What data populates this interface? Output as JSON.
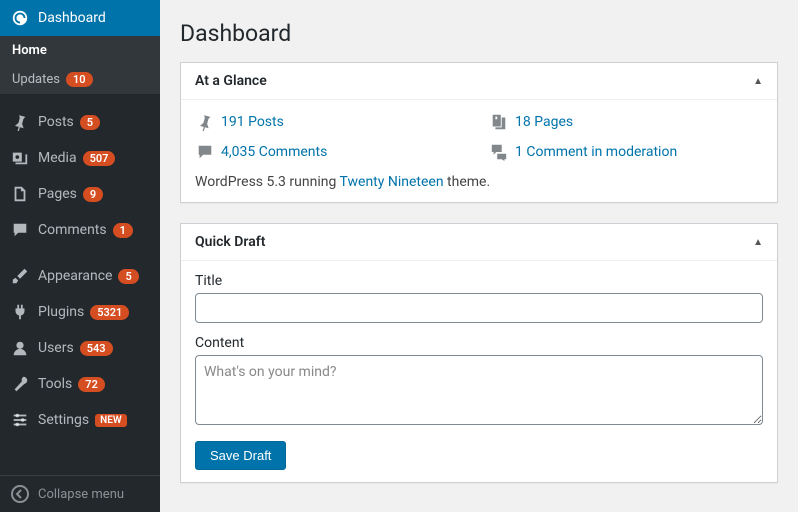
{
  "sidebar": {
    "items": [
      {
        "label": "Dashboard",
        "badge": null
      },
      {
        "label": "Posts",
        "badge": "5"
      },
      {
        "label": "Media",
        "badge": "507"
      },
      {
        "label": "Pages",
        "badge": "9"
      },
      {
        "label": "Comments",
        "badge": "1"
      },
      {
        "label": "Appearance",
        "badge": "5"
      },
      {
        "label": "Plugins",
        "badge": "5321"
      },
      {
        "label": "Users",
        "badge": "543"
      },
      {
        "label": "Tools",
        "badge": "72"
      },
      {
        "label": "Settings",
        "badge": "NEW"
      }
    ],
    "subItems": [
      {
        "label": "Home",
        "badge": null
      },
      {
        "label": "Updates",
        "badge": "10"
      }
    ],
    "collapse": "Collapse menu"
  },
  "page": {
    "title": "Dashboard"
  },
  "glance": {
    "title": "At a Glance",
    "items": [
      {
        "label": "191 Posts"
      },
      {
        "label": "18 Pages"
      },
      {
        "label": "4,035 Comments"
      },
      {
        "label": "1 Comment in moderation"
      }
    ],
    "footerPrefix": "WordPress 5.3 running ",
    "footerTheme": "Twenty Nineteen",
    "footerSuffix": " theme."
  },
  "draft": {
    "title": "Quick Draft",
    "titleLabel": "Title",
    "contentLabel": "Content",
    "placeholder": "What's on your mind?",
    "save": "Save Draft"
  }
}
